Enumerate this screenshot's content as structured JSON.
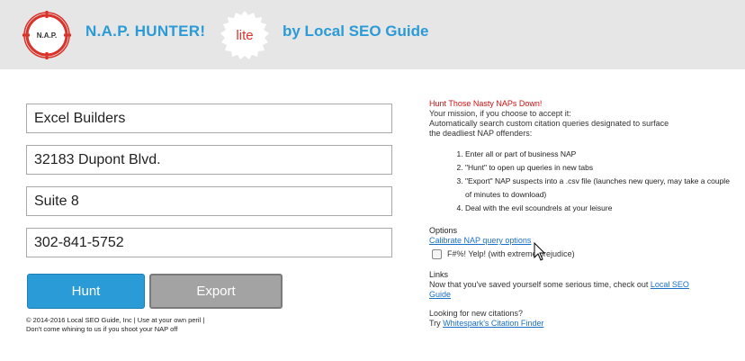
{
  "header": {
    "logo_text": "N.A.P.",
    "title": "N.A.P. HUNTER!",
    "badge": "lite",
    "subtitle": "by Local SEO Guide"
  },
  "form": {
    "business_name": "Excel Builders",
    "address_line1": "32183 Dupont Blvd.",
    "address_line2": "Suite 8",
    "phone": "302-841-5752",
    "hunt_label": "Hunt",
    "export_label": "Export"
  },
  "footer": {
    "line1": "© 2014-2016 Local SEO Guide, Inc | Use at your own peril |",
    "line2": "Don't come whining to us if you shoot your NAP off"
  },
  "info": {
    "heading": "Hunt Those Nasty NAPs Down!",
    "mission_line1": "Your mission, if you choose to accept it:",
    "mission_line2": "Automatically search custom citation queries designated to surface",
    "mission_line3": "the deadliest NAP offenders:",
    "steps": [
      "Enter all or part of business NAP",
      "\"Hunt\" to open up queries in new tabs",
      "\"Export\" NAP suspects into a .csv file (launches new query, may take a couple of minutes to download)",
      "Deal with the evil scoundrels at your leisure"
    ]
  },
  "options": {
    "label": "Options",
    "calibrate_link": "Calibrate NAP query options",
    "yelp_checkbox_label": "F#%! Yelp! (with extreme prejudice)"
  },
  "links": {
    "label": "Links",
    "saved_text": "Now that you've saved yourself some serious time, check out",
    "local_seo_link": "Local SEO Guide",
    "looking_text": "Looking for new citations?",
    "try_text": "Try",
    "whitespark_link": "Whitespark's Citation Finder"
  }
}
